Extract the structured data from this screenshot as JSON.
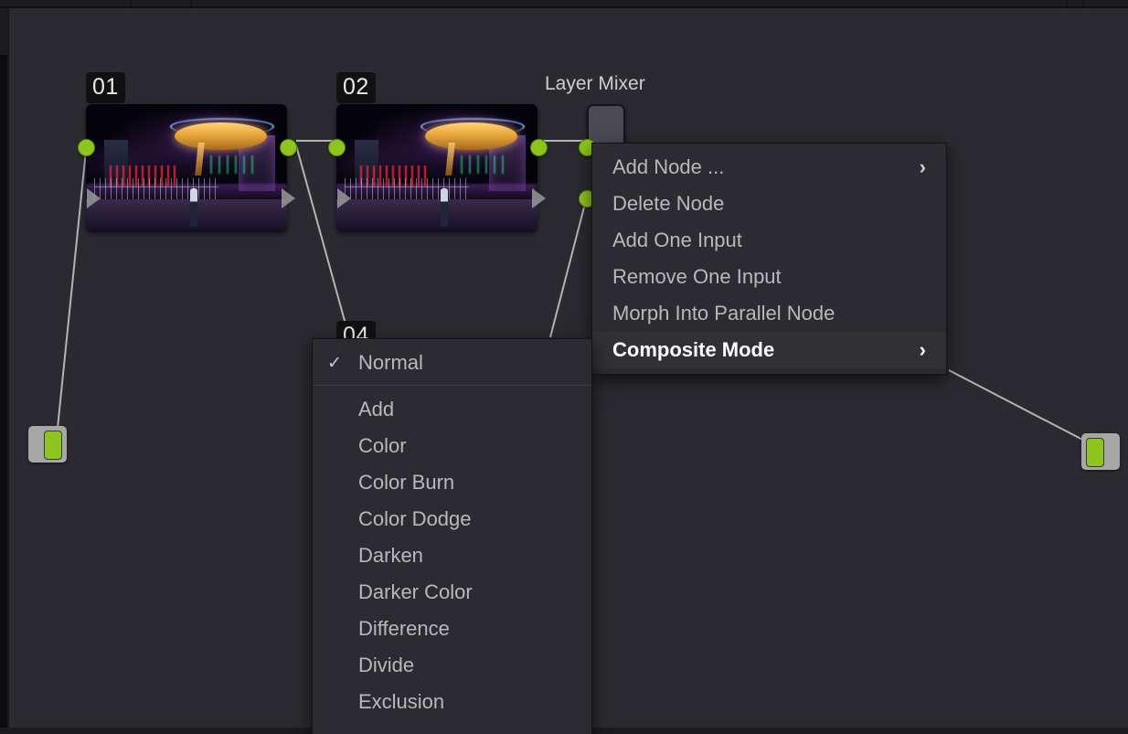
{
  "app": {
    "panel_name": "node-editor"
  },
  "graph": {
    "source_node": {
      "name": "source-node"
    },
    "output_node": {
      "name": "output-node"
    },
    "mixer": {
      "label": "Layer Mixer"
    },
    "nodes": [
      {
        "badge": "01"
      },
      {
        "badge": "02"
      },
      {
        "badge": "04"
      }
    ]
  },
  "context_menu": {
    "items": [
      {
        "label": "Add Node ...",
        "arrow": "›",
        "highlighted": false
      },
      {
        "label": "Delete Node",
        "arrow": "",
        "highlighted": false
      },
      {
        "label": "Add One Input",
        "arrow": "",
        "highlighted": false
      },
      {
        "label": "Remove One Input",
        "arrow": "",
        "highlighted": false
      },
      {
        "label": "Morph Into Parallel Node",
        "arrow": "",
        "highlighted": false
      },
      {
        "label": "Composite Mode",
        "arrow": "›",
        "highlighted": true
      }
    ]
  },
  "composite_mode_submenu": {
    "selected": "Normal",
    "check_glyph": "✓",
    "items": [
      {
        "label": "Normal",
        "checked": true
      },
      {
        "label": "Add",
        "checked": false
      },
      {
        "label": "Color",
        "checked": false
      },
      {
        "label": "Color Burn",
        "checked": false
      },
      {
        "label": "Color Dodge",
        "checked": false
      },
      {
        "label": "Darken",
        "checked": false
      },
      {
        "label": "Darker Color",
        "checked": false
      },
      {
        "label": "Difference",
        "checked": false
      },
      {
        "label": "Divide",
        "checked": false
      },
      {
        "label": "Exclusion",
        "checked": false
      }
    ]
  },
  "colors": {
    "canvas": "#2a2a30",
    "menu_bg": "#2b2b31",
    "menu_highlight": "#313135",
    "node_green": "#8dc51e",
    "wire": "#b4b4b4",
    "text": "#b9b9bd"
  }
}
